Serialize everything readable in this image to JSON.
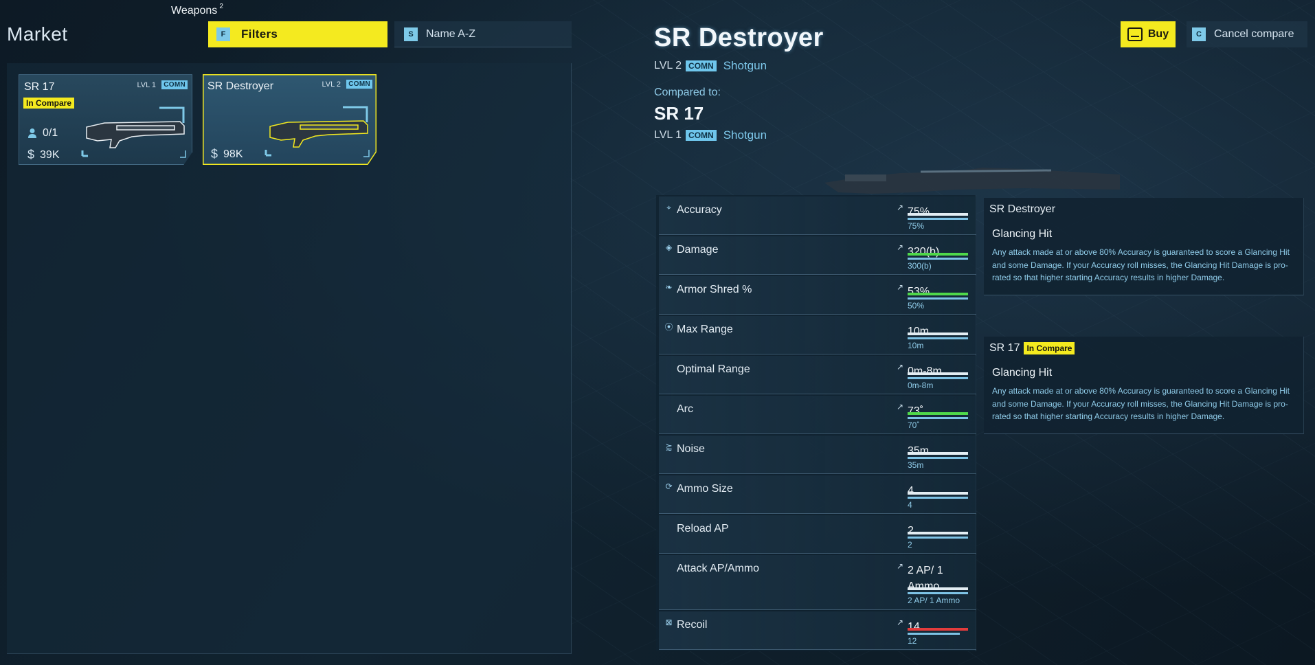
{
  "market": {
    "title": "Market",
    "category": "Weapons",
    "category_count": "2",
    "filters": {
      "key": "F",
      "label": "Filters"
    },
    "sort": {
      "key": "S",
      "label": "Name A-Z"
    },
    "items": [
      {
        "name": "SR 17",
        "level": "LVL 1",
        "tier": "COMN",
        "badge": "In Compare",
        "owned": "0/1",
        "price": "39K"
      },
      {
        "name": "SR Destroyer",
        "level": "LVL 2",
        "tier": "COMN",
        "price": "98K"
      }
    ]
  },
  "detail": {
    "name": "SR Destroyer",
    "level": "LVL 2",
    "tier": "COMN",
    "category": "Shotgun",
    "compared_label": "Compared to:",
    "compare": {
      "name": "SR 17",
      "level": "LVL 1",
      "tier": "COMN",
      "category": "Shotgun"
    },
    "buy_label": "Buy",
    "cancel": {
      "key": "C",
      "label": "Cancel compare"
    }
  },
  "stats": [
    {
      "label": "Accuracy",
      "icon": "crosshair-icon",
      "value": "75%",
      "compare": "75%",
      "trend": "up"
    },
    {
      "label": "Damage",
      "icon": "damage-icon",
      "value": "320(b)",
      "compare": "300(b)",
      "trend": "up"
    },
    {
      "label": "Armor Shred %",
      "icon": "armor-shred-icon",
      "value": "53%",
      "compare": "50%",
      "trend": "up"
    },
    {
      "label": "Max Range",
      "icon": "range-icon",
      "value": "10m",
      "compare": "10m",
      "trend": ""
    },
    {
      "label": "Optimal Range",
      "icon": "",
      "value": "0m-8m",
      "compare": "0m-8m",
      "trend": "up"
    },
    {
      "label": "Arc",
      "icon": "",
      "value": "73˚",
      "compare": "70˚",
      "trend": "up"
    },
    {
      "label": "Noise",
      "icon": "noise-icon",
      "value": "35m",
      "compare": "35m",
      "trend": ""
    },
    {
      "label": "Ammo Size",
      "icon": "reload-icon",
      "value": "4",
      "compare": "4",
      "trend": ""
    },
    {
      "label": "Reload AP",
      "icon": "",
      "value": "2",
      "compare": "2",
      "trend": ""
    },
    {
      "label": "Attack AP/Ammo",
      "icon": "",
      "value": "2 AP/ 1 Ammo",
      "compare": "2 AP/ 1 Ammo",
      "trend": "up"
    },
    {
      "label": "Recoil",
      "icon": "recoil-icon",
      "value": "14",
      "compare": "12",
      "trend": "up"
    }
  ],
  "perks": [
    {
      "weapon": "SR Destroyer",
      "title": "Glancing Hit",
      "description": "Any attack made at or above 80% Accuracy is guaranteed to score a Glancing Hit and some Damage. If your Accuracy roll misses, the Glancing Hit Damage is pro-rated so that higher starting Accuracy results in higher Damage."
    },
    {
      "weapon": "SR 17",
      "badge": "In Compare",
      "title": "Glancing Hit",
      "description": "Any attack made at or above 80% Accuracy is guaranteed to score a Glancing Hit and some Damage. If your Accuracy roll misses, the Glancing Hit Damage is pro-rated so that higher starting Accuracy results in higher Damage."
    }
  ],
  "colors": {
    "accent_yellow": "#f4ea1f",
    "accent_blue": "#7ec9e8",
    "better_green": "#4fd84a",
    "worse_red": "#e23c3c"
  }
}
